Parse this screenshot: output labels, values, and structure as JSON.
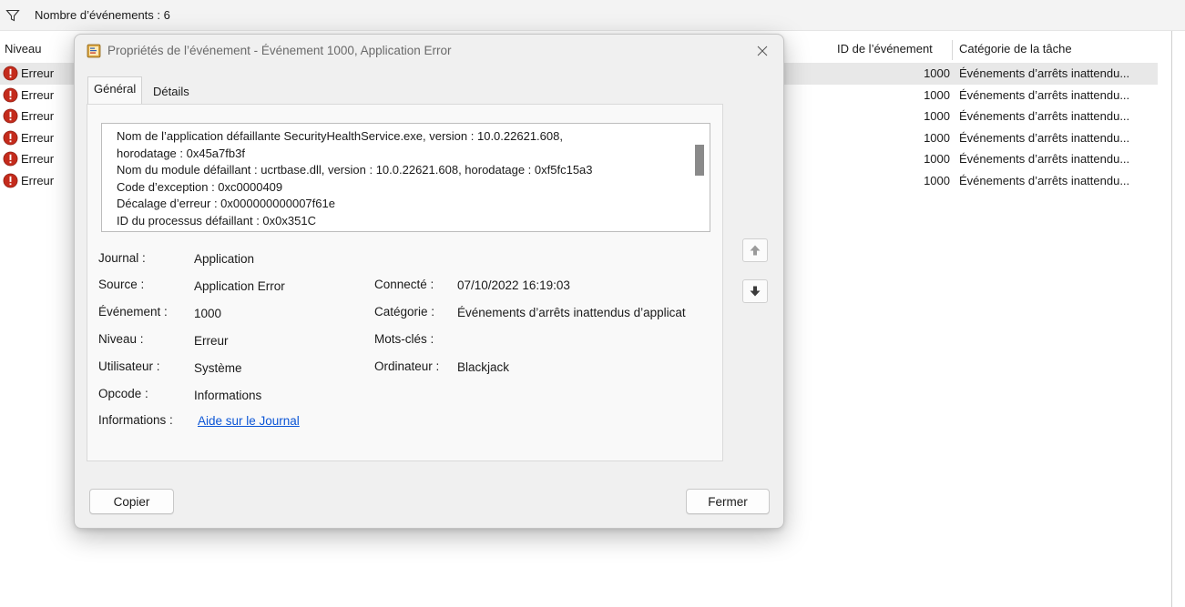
{
  "filter": {
    "icon": "funnel-icon",
    "count_text": "Nombre d’événements : 6"
  },
  "columns": {
    "level": "Niveau",
    "event_id": "ID de l’événement",
    "task_category": "Catégorie de la tâche"
  },
  "rows": [
    {
      "level": "Erreur",
      "id": "1000",
      "category": "Événements d’arrêts inattendu..."
    },
    {
      "level": "Erreur",
      "id": "1000",
      "category": "Événements d’arrêts inattendu..."
    },
    {
      "level": "Erreur",
      "id": "1000",
      "category": "Événements d’arrêts inattendu..."
    },
    {
      "level": "Erreur",
      "id": "1000",
      "category": "Événements d’arrêts inattendu..."
    },
    {
      "level": "Erreur",
      "id": "1000",
      "category": "Événements d’arrêts inattendu..."
    },
    {
      "level": "Erreur",
      "id": "1000",
      "category": "Événements d’arrêts inattendu..."
    }
  ],
  "dialog": {
    "title": "Propriétés de l’événement - Événement 1000, Application Error",
    "close_glyph": "✕",
    "tabs": [
      "Général",
      "Détails"
    ],
    "description": "Nom de l’application défaillante SecurityHealthService.exe, version : 10.0.22621.608,\nhorodatage : 0x45a7fb3f\nNom du module défaillant : ucrtbase.dll, version : 10.0.22621.608, horodatage : 0xf5fc15a3\nCode d’exception : 0xc0000409\nDécalage d’erreur : 0x000000000007f61e\nID du processus défaillant : 0x0x351C",
    "fields": {
      "journal_label": "Journal :",
      "journal_value": "Application",
      "source_label": "Source :",
      "source_value": "Application Error",
      "event_label": "Événement :",
      "event_value": "1000",
      "level_label": "Niveau :",
      "level_value": "Erreur",
      "user_label": "Utilisateur :",
      "user_value": "Système",
      "opcode_label": "Opcode :",
      "opcode_value": "Informations",
      "info_label": "Informations :",
      "info_link": "Aide sur le Journal",
      "logged_label": "Connecté :",
      "logged_value": "07/10/2022 16:19:03",
      "category_label": "Catégorie :",
      "category_value": "Événements d’arrêts inattendus d’applicat",
      "keywords_label": "Mots-clés :",
      "keywords_value": "",
      "computer_label": "Ordinateur :",
      "computer_value": "Blackjack"
    },
    "buttons": {
      "copy": "Copier",
      "close": "Fermer"
    }
  },
  "colors": {
    "error_red": "#c42b1c",
    "link_blue": "#0b55d6",
    "dialog_bg": "#f0f0f0"
  }
}
